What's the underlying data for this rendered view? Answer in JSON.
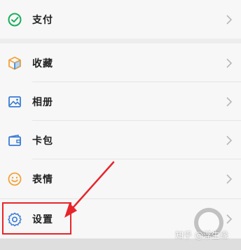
{
  "menu": {
    "items": [
      {
        "label": "支付",
        "icon": "pay-check-icon"
      },
      {
        "label": "收藏",
        "icon": "favorites-cube-icon"
      },
      {
        "label": "相册",
        "icon": "album-picture-icon"
      },
      {
        "label": "卡包",
        "icon": "card-wallet-icon"
      },
      {
        "label": "表情",
        "icon": "emoji-smile-icon"
      },
      {
        "label": "设置",
        "icon": "settings-gear-icon"
      }
    ]
  },
  "annotation": {
    "color": "#e8242b"
  },
  "watermark": {
    "text": "知乎 @浮生缘"
  },
  "colors": {
    "pay_green": "#19ad5c",
    "favorites_orange": "#f2a23a",
    "favorites_blue": "#3a8ee6",
    "album_blue": "#3a7bd5",
    "card_blue": "#3a7bd5",
    "emoji_orange": "#f2a23a",
    "settings_blue": "#3a7bd5"
  }
}
